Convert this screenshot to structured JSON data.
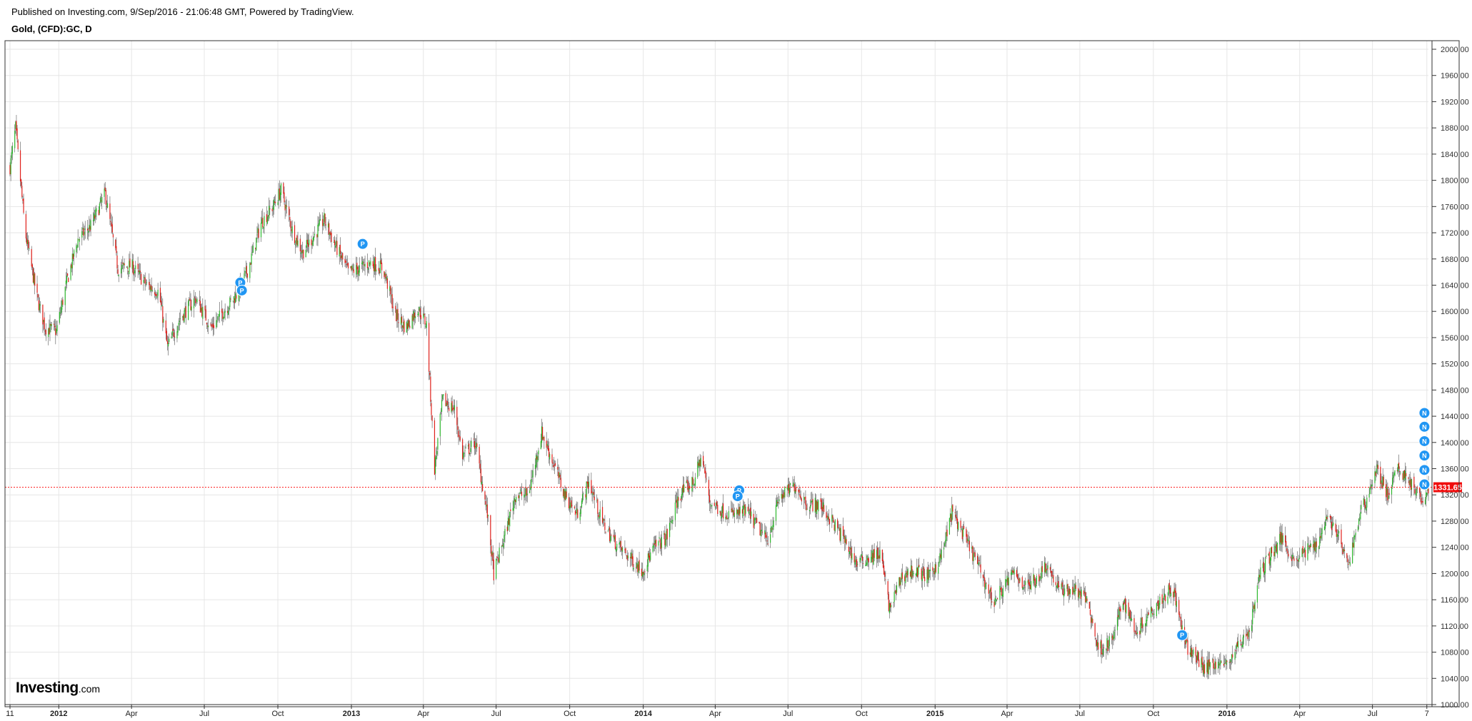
{
  "header": {
    "published": "Published on Investing.com, 9/Sep/2016 - 21:06:48 GMT, Powered by TradingView.",
    "symbol": "Gold, (CFD):GC, D"
  },
  "logo": {
    "main": "Investing",
    "sub": ".com"
  },
  "colors": {
    "up": "#2db82d",
    "down": "#e0201b",
    "grid": "#e6e6e6",
    "last_price_line": "#ff2222",
    "last_price_badge": "#f00d0d",
    "event_marker": "#2196f3"
  },
  "chart_data": {
    "type": "candlestick",
    "title": "Gold, (CFD):GC, D",
    "y_axis": {
      "min": 1000,
      "max": 2000,
      "step": 40,
      "side": "right",
      "decimals": 2
    },
    "y_ticks": [
      "2000.00",
      "1960.00",
      "1920.00",
      "1880.00",
      "1840.00",
      "1800.00",
      "1760.00",
      "1720.00",
      "1680.00",
      "1640.00",
      "1600.00",
      "1560.00",
      "1520.00",
      "1480.00",
      "1440.00",
      "1400.00",
      "1360.00",
      "1320.00",
      "1280.00",
      "1240.00",
      "1200.00",
      "1160.00",
      "1120.00",
      "1080.00",
      "1040.00",
      "1000.00"
    ],
    "x_range": [
      "2011-11-01",
      "2016-09-09"
    ],
    "x_ticks": [
      {
        "label": "11",
        "date": "2011-11-01",
        "bold": false
      },
      {
        "label": "2012",
        "date": "2012-01-01",
        "bold": true
      },
      {
        "label": "Apr",
        "date": "2012-04-01",
        "bold": false
      },
      {
        "label": "Jul",
        "date": "2012-07-01",
        "bold": false
      },
      {
        "label": "Oct",
        "date": "2012-10-01",
        "bold": false
      },
      {
        "label": "2013",
        "date": "2013-01-01",
        "bold": true
      },
      {
        "label": "Apr",
        "date": "2013-04-01",
        "bold": false
      },
      {
        "label": "Jul",
        "date": "2013-07-01",
        "bold": false
      },
      {
        "label": "Oct",
        "date": "2013-10-01",
        "bold": false
      },
      {
        "label": "2014",
        "date": "2014-01-01",
        "bold": true
      },
      {
        "label": "Apr",
        "date": "2014-04-01",
        "bold": false
      },
      {
        "label": "Jul",
        "date": "2014-07-01",
        "bold": false
      },
      {
        "label": "Oct",
        "date": "2014-10-01",
        "bold": false
      },
      {
        "label": "2015",
        "date": "2015-01-01",
        "bold": true
      },
      {
        "label": "Apr",
        "date": "2015-04-01",
        "bold": false
      },
      {
        "label": "Jul",
        "date": "2015-07-01",
        "bold": false
      },
      {
        "label": "Oct",
        "date": "2015-10-01",
        "bold": false
      },
      {
        "label": "2016",
        "date": "2016-01-01",
        "bold": true
      },
      {
        "label": "Apr",
        "date": "2016-04-01",
        "bold": false
      },
      {
        "label": "Jul",
        "date": "2016-07-01",
        "bold": false
      },
      {
        "label": "7",
        "date": "2016-09-07",
        "bold": false
      }
    ],
    "last_price": 1331.65,
    "last_price_label": "1331.65",
    "grid": true,
    "close_series": [
      {
        "date": "2011-11-01",
        "close": 1820
      },
      {
        "date": "2011-11-08",
        "close": 1880
      },
      {
        "date": "2011-11-20",
        "close": 1720
      },
      {
        "date": "2011-12-05",
        "close": 1620
      },
      {
        "date": "2011-12-15",
        "close": 1575
      },
      {
        "date": "2011-12-29",
        "close": 1570
      },
      {
        "date": "2012-01-10",
        "close": 1640
      },
      {
        "date": "2012-01-25",
        "close": 1710
      },
      {
        "date": "2012-02-10",
        "close": 1730
      },
      {
        "date": "2012-02-28",
        "close": 1780
      },
      {
        "date": "2012-03-15",
        "close": 1665
      },
      {
        "date": "2012-04-01",
        "close": 1670
      },
      {
        "date": "2012-04-20",
        "close": 1640
      },
      {
        "date": "2012-05-05",
        "close": 1630
      },
      {
        "date": "2012-05-16",
        "close": 1545
      },
      {
        "date": "2012-06-01",
        "close": 1590
      },
      {
        "date": "2012-06-20",
        "close": 1620
      },
      {
        "date": "2012-07-10",
        "close": 1575
      },
      {
        "date": "2012-07-25",
        "close": 1600
      },
      {
        "date": "2012-08-10",
        "close": 1625
      },
      {
        "date": "2012-08-25",
        "close": 1665
      },
      {
        "date": "2012-09-10",
        "close": 1735
      },
      {
        "date": "2012-09-25",
        "close": 1760
      },
      {
        "date": "2012-10-05",
        "close": 1785
      },
      {
        "date": "2012-10-20",
        "close": 1720
      },
      {
        "date": "2012-11-01",
        "close": 1690
      },
      {
        "date": "2012-11-15",
        "close": 1715
      },
      {
        "date": "2012-11-28",
        "close": 1740
      },
      {
        "date": "2012-12-10",
        "close": 1705
      },
      {
        "date": "2012-12-28",
        "close": 1660
      },
      {
        "date": "2013-01-10",
        "close": 1665
      },
      {
        "date": "2013-01-25",
        "close": 1675
      },
      {
        "date": "2013-02-10",
        "close": 1665
      },
      {
        "date": "2013-02-25",
        "close": 1595
      },
      {
        "date": "2013-03-10",
        "close": 1575
      },
      {
        "date": "2013-03-25",
        "close": 1605
      },
      {
        "date": "2013-04-05",
        "close": 1580
      },
      {
        "date": "2013-04-15",
        "close": 1360
      },
      {
        "date": "2013-04-25",
        "close": 1465
      },
      {
        "date": "2013-05-10",
        "close": 1450
      },
      {
        "date": "2013-05-20",
        "close": 1380
      },
      {
        "date": "2013-06-05",
        "close": 1400
      },
      {
        "date": "2013-06-20",
        "close": 1290
      },
      {
        "date": "2013-06-28",
        "close": 1200
      },
      {
        "date": "2013-07-10",
        "close": 1250
      },
      {
        "date": "2013-07-25",
        "close": 1320
      },
      {
        "date": "2013-08-10",
        "close": 1320
      },
      {
        "date": "2013-08-27",
        "close": 1415
      },
      {
        "date": "2013-09-10",
        "close": 1370
      },
      {
        "date": "2013-09-25",
        "close": 1320
      },
      {
        "date": "2013-10-10",
        "close": 1290
      },
      {
        "date": "2013-10-25",
        "close": 1340
      },
      {
        "date": "2013-11-10",
        "close": 1280
      },
      {
        "date": "2013-11-25",
        "close": 1250
      },
      {
        "date": "2013-12-10",
        "close": 1230
      },
      {
        "date": "2013-12-31",
        "close": 1205
      },
      {
        "date": "2014-01-15",
        "close": 1240
      },
      {
        "date": "2014-01-30",
        "close": 1255
      },
      {
        "date": "2014-02-15",
        "close": 1320
      },
      {
        "date": "2014-03-05",
        "close": 1340
      },
      {
        "date": "2014-03-15",
        "close": 1380
      },
      {
        "date": "2014-03-25",
        "close": 1310
      },
      {
        "date": "2014-04-10",
        "close": 1295
      },
      {
        "date": "2014-04-25",
        "close": 1290
      },
      {
        "date": "2014-05-10",
        "close": 1295
      },
      {
        "date": "2014-05-25",
        "close": 1270
      },
      {
        "date": "2014-06-05",
        "close": 1250
      },
      {
        "date": "2014-06-20",
        "close": 1315
      },
      {
        "date": "2014-07-10",
        "close": 1335
      },
      {
        "date": "2014-07-25",
        "close": 1305
      },
      {
        "date": "2014-08-10",
        "close": 1305
      },
      {
        "date": "2014-08-25",
        "close": 1280
      },
      {
        "date": "2014-09-10",
        "close": 1250
      },
      {
        "date": "2014-09-25",
        "close": 1215
      },
      {
        "date": "2014-10-10",
        "close": 1225
      },
      {
        "date": "2014-10-25",
        "close": 1230
      },
      {
        "date": "2014-11-05",
        "close": 1145
      },
      {
        "date": "2014-11-20",
        "close": 1195
      },
      {
        "date": "2014-12-05",
        "close": 1205
      },
      {
        "date": "2014-12-25",
        "close": 1195
      },
      {
        "date": "2015-01-10",
        "close": 1230
      },
      {
        "date": "2015-01-22",
        "close": 1295
      },
      {
        "date": "2015-02-05",
        "close": 1260
      },
      {
        "date": "2015-02-25",
        "close": 1210
      },
      {
        "date": "2015-03-15",
        "close": 1155
      },
      {
        "date": "2015-03-30",
        "close": 1185
      },
      {
        "date": "2015-04-10",
        "close": 1200
      },
      {
        "date": "2015-04-25",
        "close": 1180
      },
      {
        "date": "2015-05-10",
        "close": 1195
      },
      {
        "date": "2015-05-20",
        "close": 1215
      },
      {
        "date": "2015-06-05",
        "close": 1175
      },
      {
        "date": "2015-06-25",
        "close": 1175
      },
      {
        "date": "2015-07-10",
        "close": 1160
      },
      {
        "date": "2015-07-24",
        "close": 1085
      },
      {
        "date": "2015-08-10",
        "close": 1095
      },
      {
        "date": "2015-08-24",
        "close": 1160
      },
      {
        "date": "2015-09-10",
        "close": 1110
      },
      {
        "date": "2015-09-25",
        "close": 1140
      },
      {
        "date": "2015-10-10",
        "close": 1160
      },
      {
        "date": "2015-10-25",
        "close": 1180
      },
      {
        "date": "2015-11-10",
        "close": 1090
      },
      {
        "date": "2015-11-25",
        "close": 1070
      },
      {
        "date": "2015-12-05",
        "close": 1055
      },
      {
        "date": "2015-12-17",
        "close": 1065
      },
      {
        "date": "2015-12-31",
        "close": 1060
      },
      {
        "date": "2016-01-15",
        "close": 1090
      },
      {
        "date": "2016-01-30",
        "close": 1115
      },
      {
        "date": "2016-02-11",
        "close": 1200
      },
      {
        "date": "2016-02-25",
        "close": 1230
      },
      {
        "date": "2016-03-10",
        "close": 1255
      },
      {
        "date": "2016-03-25",
        "close": 1220
      },
      {
        "date": "2016-04-10",
        "close": 1235
      },
      {
        "date": "2016-04-25",
        "close": 1250
      },
      {
        "date": "2016-05-05",
        "close": 1290
      },
      {
        "date": "2016-05-20",
        "close": 1255
      },
      {
        "date": "2016-05-31",
        "close": 1210
      },
      {
        "date": "2016-06-15",
        "close": 1290
      },
      {
        "date": "2016-06-24",
        "close": 1315
      },
      {
        "date": "2016-07-06",
        "close": 1360
      },
      {
        "date": "2016-07-20",
        "close": 1320
      },
      {
        "date": "2016-08-02",
        "close": 1360
      },
      {
        "date": "2016-08-15",
        "close": 1345
      },
      {
        "date": "2016-08-30",
        "close": 1310
      },
      {
        "date": "2016-09-09",
        "close": 1332
      }
    ],
    "event_markers": [
      {
        "date": "2012-08-15",
        "price": 1644,
        "label": "P"
      },
      {
        "date": "2012-08-17",
        "price": 1632,
        "label": "P"
      },
      {
        "date": "2013-01-15",
        "price": 1703,
        "label": "P"
      },
      {
        "date": "2014-05-01",
        "price": 1327,
        "label": "P"
      },
      {
        "date": "2014-04-29",
        "price": 1318,
        "label": "P"
      },
      {
        "date": "2015-11-06",
        "price": 1106,
        "label": "P"
      },
      {
        "date": "2016-09-04",
        "price": 1445,
        "label": "N"
      },
      {
        "date": "2016-09-04",
        "price": 1424,
        "label": "N"
      },
      {
        "date": "2016-09-04",
        "price": 1402,
        "label": "N"
      },
      {
        "date": "2016-09-04",
        "price": 1380,
        "label": "N"
      },
      {
        "date": "2016-09-04",
        "price": 1358,
        "label": "N"
      },
      {
        "date": "2016-09-04",
        "price": 1336,
        "label": "N"
      }
    ]
  }
}
